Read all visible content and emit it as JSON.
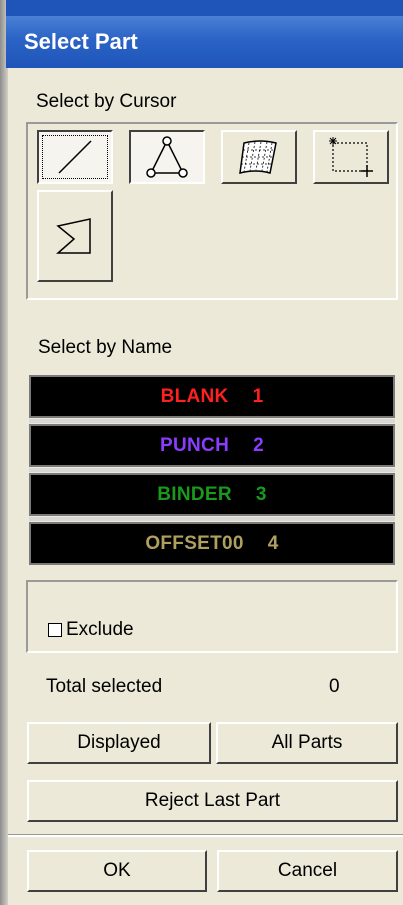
{
  "window": {
    "title": "Select Part"
  },
  "cursor_section": {
    "label": "Select by Cursor",
    "tools": [
      {
        "name": "line-tool",
        "icon": "diagonal-line-icon"
      },
      {
        "name": "node-triangle-tool",
        "icon": "triangle-nodes-icon"
      },
      {
        "name": "surface-tool",
        "icon": "mesh-surface-icon"
      },
      {
        "name": "rectangle-select-tool",
        "icon": "rectangle-select-icon"
      },
      {
        "name": "polygon-select-tool",
        "icon": "polygon-select-icon"
      }
    ]
  },
  "name_section": {
    "label": "Select by Name",
    "parts": [
      {
        "name": "BLANK",
        "id": "1",
        "color": "#ff2020"
      },
      {
        "name": "PUNCH",
        "id": "2",
        "color": "#8a3cff"
      },
      {
        "name": "BINDER",
        "id": "3",
        "color": "#1a9a1a"
      },
      {
        "name": "OFFSET00",
        "id": "4",
        "color": "#b0a060"
      }
    ]
  },
  "exclude": {
    "label": "Exclude",
    "checked": false
  },
  "total": {
    "label": "Total selected",
    "value": "0"
  },
  "buttons": {
    "displayed": "Displayed",
    "all_parts": "All Parts",
    "reject_last": "Reject Last Part",
    "ok": "OK",
    "cancel": "Cancel"
  }
}
